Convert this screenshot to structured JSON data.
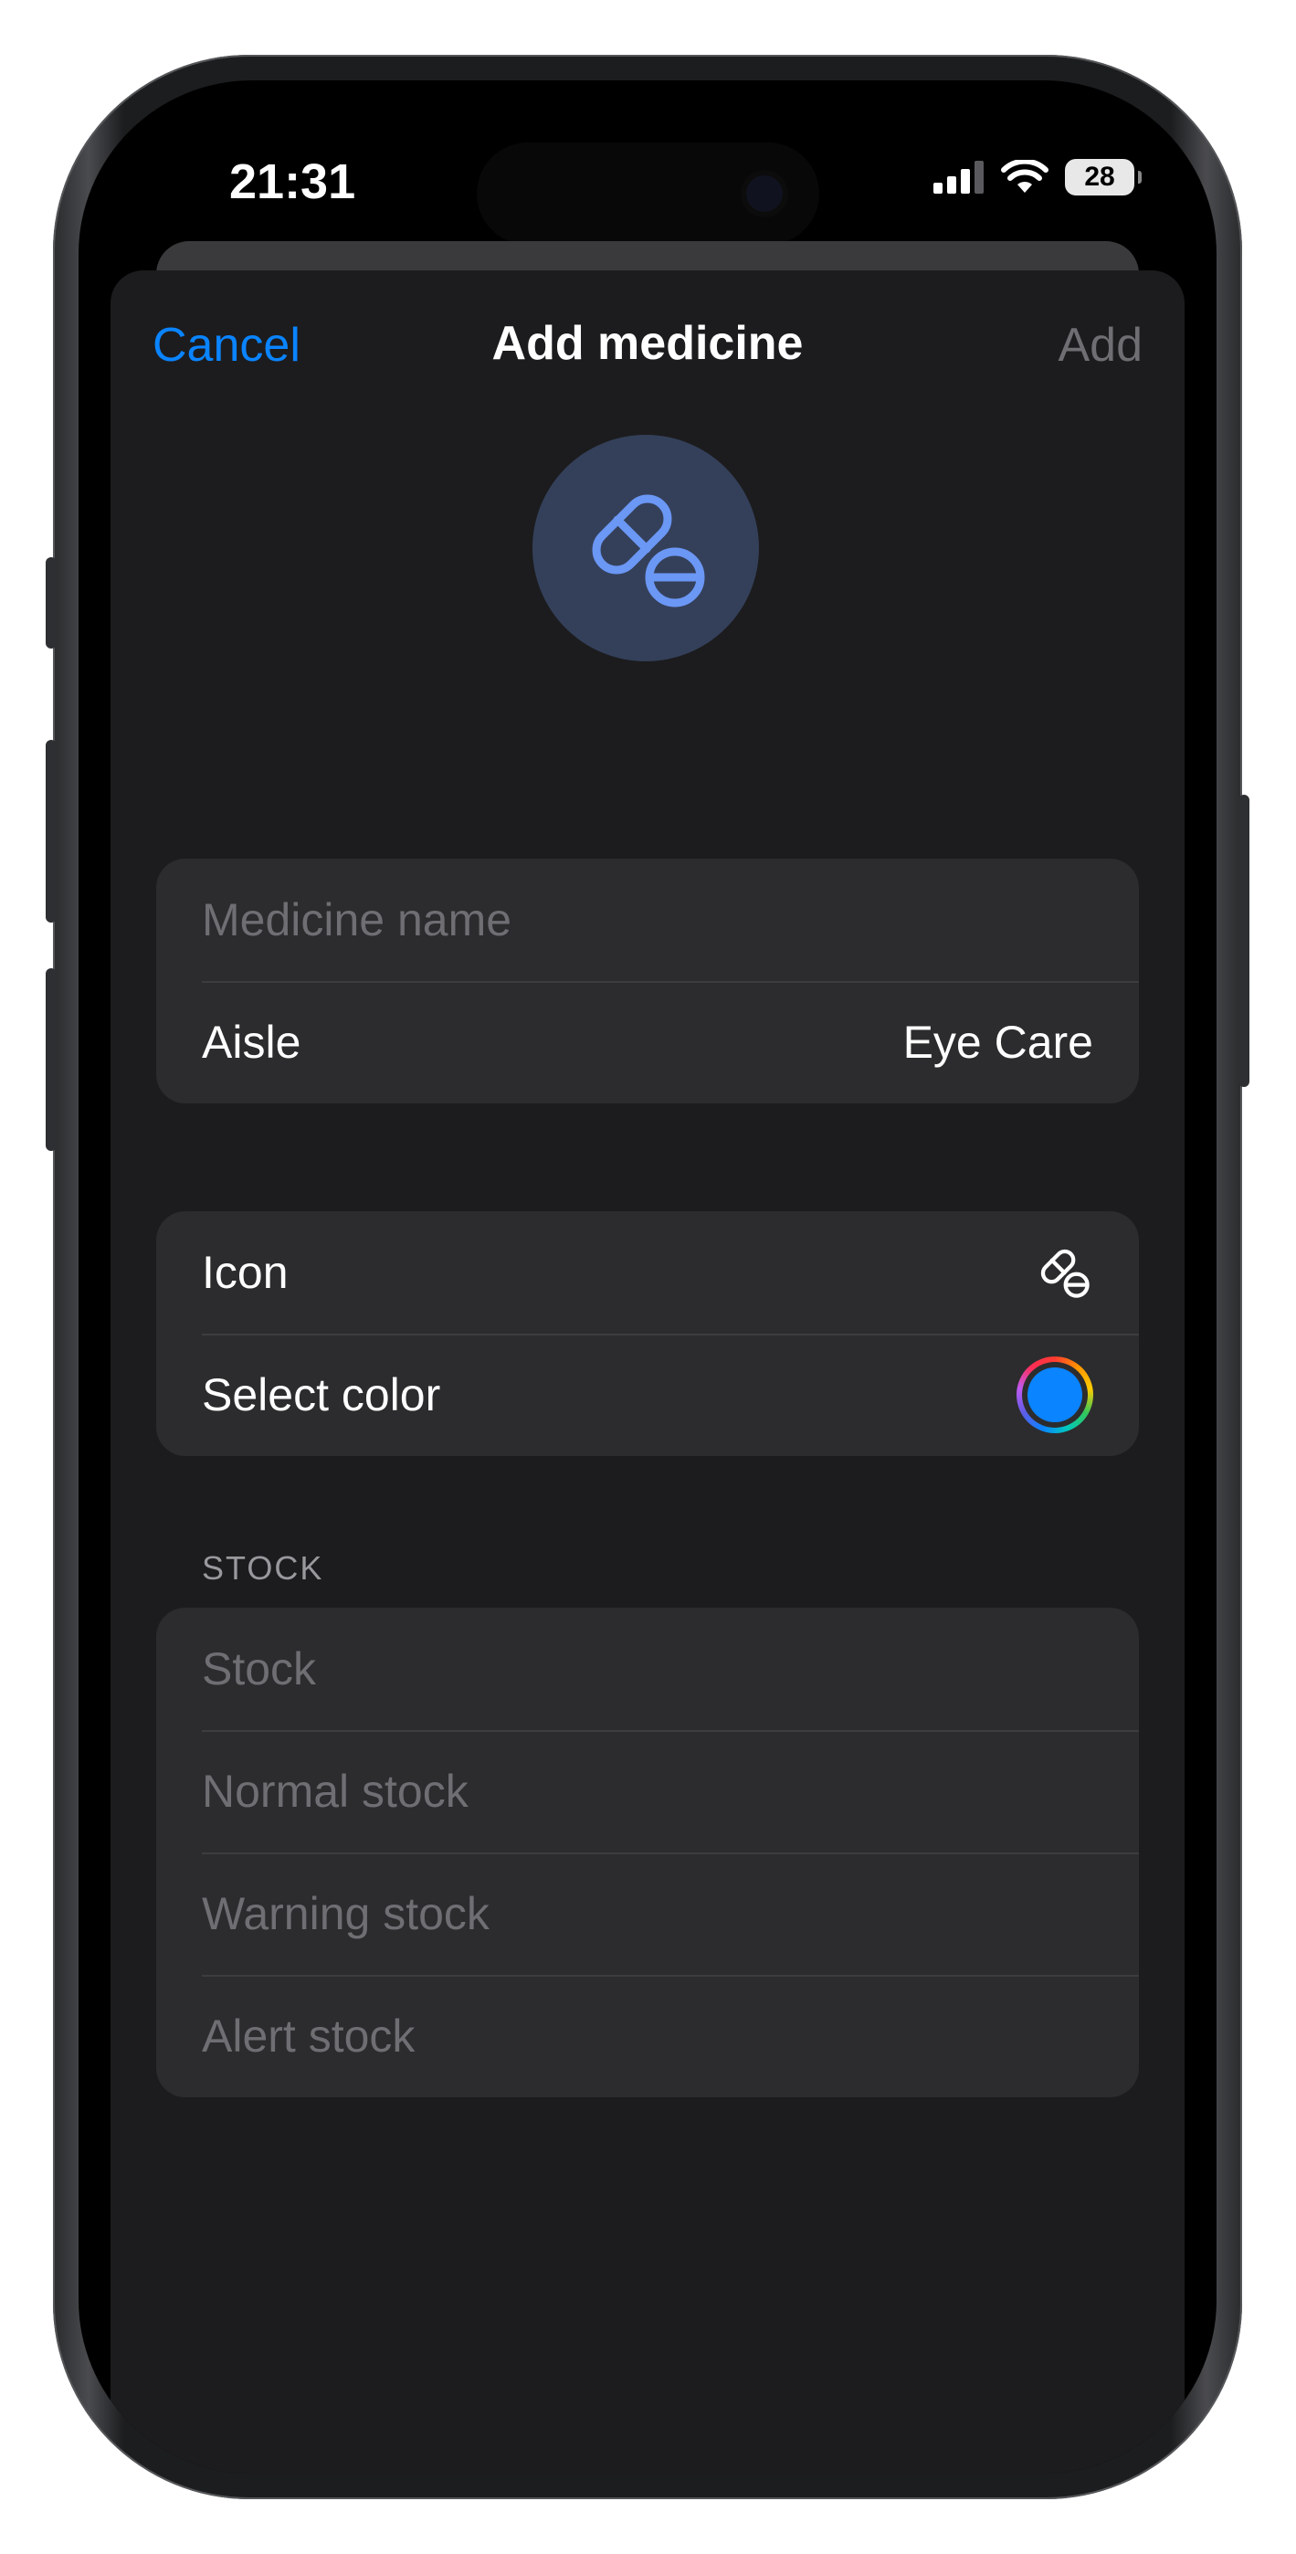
{
  "status": {
    "time": "21:31",
    "battery": "28"
  },
  "nav": {
    "cancel": "Cancel",
    "title": "Add medicine",
    "add": "Add"
  },
  "main_icon": "pill-icon",
  "basic": {
    "name_placeholder": "Medicine name",
    "aisle_label": "Aisle",
    "aisle_value": "Eye Care"
  },
  "appearance": {
    "icon_label": "Icon",
    "icon_value": "pill-icon",
    "color_label": "Select color",
    "color_value": "#0a84ff"
  },
  "stock": {
    "header": "STOCK",
    "stock_placeholder": "Stock",
    "normal_placeholder": "Normal stock",
    "warning_placeholder": "Warning stock",
    "alert_placeholder": "Alert stock"
  },
  "colors": {
    "accent": "#0a84ff",
    "icon_tint": "#6b97f5",
    "sheet_bg": "#1c1c1e",
    "cell_bg": "#2c2c2e"
  }
}
